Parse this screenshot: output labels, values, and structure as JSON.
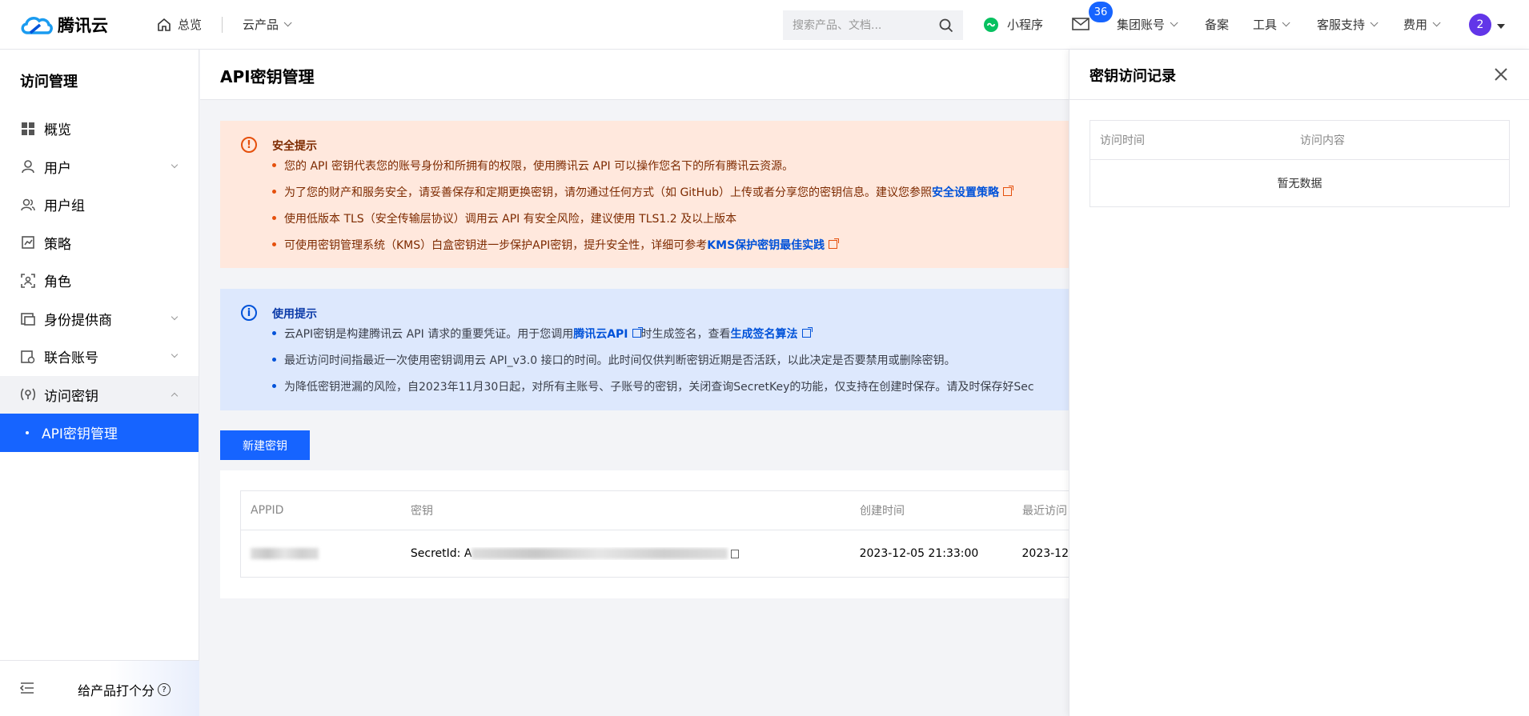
{
  "topbar": {
    "logo_text": "腾讯云",
    "home": "总览",
    "products": "云产品",
    "search_placeholder": "搜索产品、文档...",
    "mini_program": "小程序",
    "mail_badge": "36",
    "group_account": "集团账号",
    "filing": "备案",
    "tools": "工具",
    "support": "客服支持",
    "billing": "费用",
    "avatar": "2"
  },
  "sidebar": {
    "title": "访问管理",
    "items": [
      {
        "label": "概览"
      },
      {
        "label": "用户"
      },
      {
        "label": "用户组"
      },
      {
        "label": "策略"
      },
      {
        "label": "角色"
      },
      {
        "label": "身份提供商"
      },
      {
        "label": "联合账号"
      },
      {
        "label": "访问密钥"
      },
      {
        "label": "API密钥管理"
      }
    ],
    "rate": "给产品打个分"
  },
  "main": {
    "title": "API密钥管理",
    "security": {
      "title": "安全提示",
      "lines": [
        "您的 API 密钥代表您的账号身份和所拥有的权限，使用腾讯云 API 可以操作您名下的所有腾讯云资源。",
        "为了您的财产和服务安全，请妥善保存和定期更换密钥，请勿通过任何方式（如 GitHub）上传或者分享您的密钥信息。建议您参照",
        "使用低版本 TLS（安全传输层协议）调用云 API 有安全风险，建议使用 TLS1.2 及以上版本",
        "可使用密钥管理系统（KMS）白盒密钥进一步保护API密钥，提升安全性，详细可参考"
      ],
      "link1": "安全设置策略",
      "link2": "KMS保护密钥最佳实践"
    },
    "usage": {
      "title": "使用提示",
      "line1a": "云API密钥是构建腾讯云 API 请求的重要凭证。用于您调用",
      "line1_link1": "腾讯云API",
      "line1b": "时生成签名，查看",
      "line1_link2": "生成签名算法",
      "line2": "最近访问时间指最近一次使用密钥调用云 API_v3.0 接口的时间。此时间仅供判断密钥近期是否活跃，以此决定是否要禁用或删除密钥。",
      "line3": "为降低密钥泄漏的风险，自2023年11月30日起，对所有主账号、子账号的密钥，关闭查询SecretKey的功能，仅支持在创建时保存。请及时保存好Sec"
    },
    "new_key_button": "新建密钥",
    "table": {
      "headers": [
        "APPID",
        "密钥",
        "创建时间",
        "最近访问"
      ],
      "row": {
        "secret_id_label": "SecretId: A",
        "created": "2023-12-05 21:33:00",
        "last_access": "2023-12"
      }
    }
  },
  "panel": {
    "title": "密钥访问记录",
    "headers": [
      "访问时间",
      "访问内容"
    ],
    "empty": "暂无数据"
  },
  "colors": {
    "primary": "#1664ff",
    "warn_bg": "#ffe8dd",
    "info_bg": "#dde8fd"
  }
}
